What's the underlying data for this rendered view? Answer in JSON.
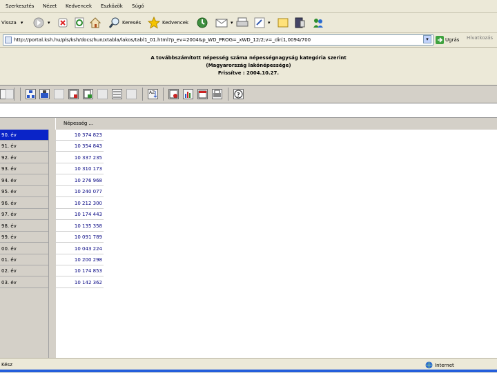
{
  "menu": {
    "items": [
      "Szerkesztés",
      "Nézet",
      "Kedvencek",
      "Eszközök",
      "Súgó"
    ]
  },
  "toolbar": {
    "back_label": "Vissza",
    "search_label": "Keresés",
    "favorites_label": "Kedvencek"
  },
  "address": {
    "url": "http://portal.ksh.hu/pls/ksh/docs/hun/xtabla/lakos/tabl1_01.html?p_ev=2004&p_WD_PROG=_xWD_12/2;v=_dir(1,0094/700",
    "go_label": "Ugrás",
    "links_label": "Hivatkozás"
  },
  "report": {
    "title": "A továbbszámított népesség száma népességnagyság kategória szerint",
    "subtitle": "(Magyarország lakónépessége)",
    "updated": "Frissítve : 2004.10.27."
  },
  "table": {
    "column_header": "Népesség ...",
    "years": [
      "90. év",
      "91. év",
      "92. év",
      "93. év",
      "94. év",
      "95. év",
      "96. év",
      "97. év",
      "98. év",
      "99. év",
      "00. év",
      "01. év",
      "02. év",
      "03. év"
    ],
    "values": [
      "10 374 823",
      "10 354 843",
      "10 337 235",
      "10 310 173",
      "10 276 968",
      "10 240 077",
      "10 212 300",
      "10 174 443",
      "10 135 358",
      "10 091 789",
      "10 043 224",
      "10 200 298",
      "10 174 853",
      "10 142 362"
    ]
  },
  "status": {
    "left_text": "Kész",
    "zone_label": "Internet"
  },
  "colors": {
    "selection": "#0a24c8",
    "value_text": "#000080",
    "chrome": "#ece9d8",
    "report_toolbar": "#d4d0c8",
    "taskbar": "#245edb"
  }
}
